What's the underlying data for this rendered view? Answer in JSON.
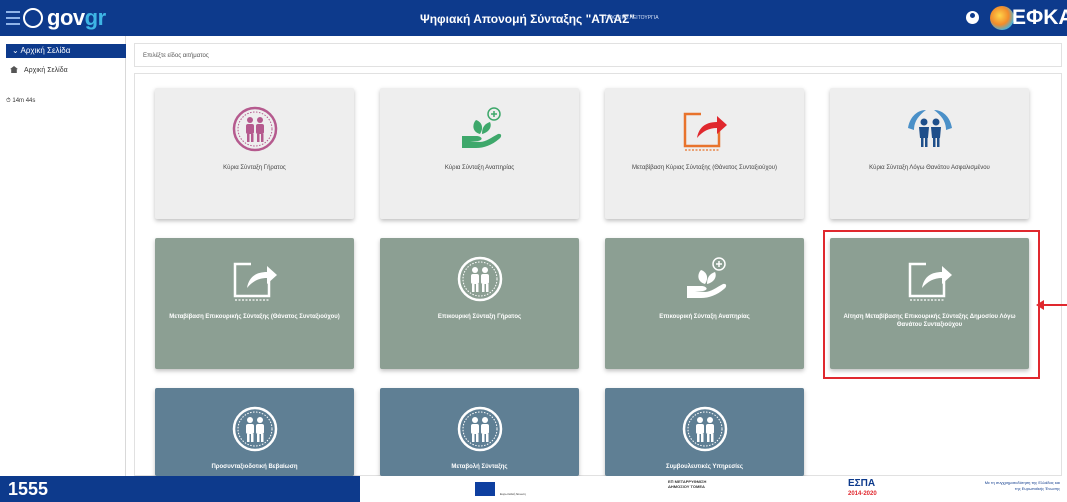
{
  "header": {
    "logo_prefix": "gov",
    "logo_suffix": "gr",
    "title": "Ψηφιακή Απονομή Σύνταξης \"ΑΤΛΑΣ\"",
    "mode": "ΠΙΛΟΤΙΚΗ ΛΕΙΤΟΥΡΓΙΑ",
    "agency": "e-ΕΦΚΑ",
    "agency_prefix": "",
    "agency_name": "ΕΦΚΑ"
  },
  "sidebar": {
    "section": "Αρχική Σελίδα",
    "items": [
      {
        "label": "Αρχική Σελίδα"
      }
    ],
    "timer": "14m 44s"
  },
  "main": {
    "prompt": "Επιλέξτε είδος αιτήματος",
    "cards": [
      {
        "label": "Κύρια Σύνταξη Γήρατος",
        "icon": "elderly-couple-icon"
      },
      {
        "label": "Κύρια Σύνταξη Αναπηρίας",
        "icon": "hand-plant-icon"
      },
      {
        "label": "Μεταβίβαση Κύριας Σύνταξης (Θάνατος Συνταξιούχου)",
        "icon": "transfer-arrow-icon"
      },
      {
        "label": "Κύρια Σύνταξη Λόγω Θανάτου Ασφαλισμένου",
        "icon": "family-protection-icon"
      },
      {
        "label": "Μεταβίβαση Επικουρικής Σύνταξης (Θάνατος Συνταξιούχου)",
        "icon": "transfer-arrow-icon"
      },
      {
        "label": "Επικουρική Σύνταξη Γήρατος",
        "icon": "elderly-couple-icon"
      },
      {
        "label": "Επικουρική Σύνταξη Αναπηρίας",
        "icon": "hand-plant-icon"
      },
      {
        "label": "Αίτηση Μεταβίβασης Επικουρικής Σύνταξης Δημοσίου Λόγω Θανάτου Συνταξιούχου",
        "icon": "transfer-arrow-icon"
      },
      {
        "label": "Προσυνταξιοδοτική Βεβαίωση",
        "icon": "elderly-couple-icon"
      },
      {
        "label": "Μεταβολή Σύνταξης",
        "icon": "elderly-couple-icon"
      },
      {
        "label": "Συμβουλευτικές Υπηρεσίες",
        "icon": "elderly-couple-icon"
      }
    ]
  },
  "footer": {
    "phone": "1555",
    "eu_text": "Ευρωπαϊκή Ένωση",
    "program": "ΕΠ ΜΕΤΑΡΡΥΘΜΙΣΗ ΔΗΜΟΣΙΟΥ ΤΟΜΕΑ",
    "espa": "ΕΣΠΑ",
    "espa_years": "2014-2020",
    "note": "Με τη συγχρηματοδότηση της Ελλάδας και της Ευρωπαϊκής Ένωσης"
  },
  "colors": {
    "header": "#0d3a8c",
    "card_light": "#eeeeee",
    "card_green": "#8c9f93",
    "card_blue": "#5f7f94",
    "highlight": "#e0282e"
  }
}
